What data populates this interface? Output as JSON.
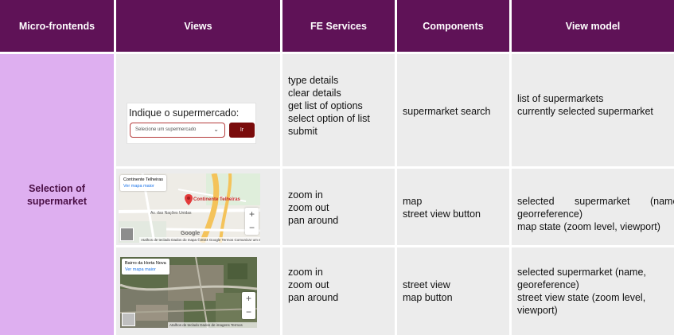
{
  "headers": {
    "micro_frontends": "Micro-frontends",
    "views": "Views",
    "fe_services": "FE Services",
    "components": "Components",
    "view_model": "View model"
  },
  "micro_frontend": {
    "name_line1": "Selection of",
    "name_line2": "supermarket"
  },
  "rows": [
    {
      "fe_services": [
        "type details",
        "clear details",
        "get list of options",
        "select option of list",
        "submit"
      ],
      "components": [
        "supermarket search"
      ],
      "view_model": [
        "list of supermarkets",
        "currently selected supermarket"
      ],
      "view": {
        "label": "Indique o supermercado:",
        "select_placeholder": "Selecione um supermercado",
        "button": "Ir"
      }
    },
    {
      "fe_services": [
        "zoom in",
        "zoom out",
        "pan around"
      ],
      "components": [
        "map",
        "street view button"
      ],
      "view_model": [
        "selected supermarket (name,",
        "georreference)",
        "map state (zoom level, viewport)"
      ],
      "view": {
        "place": "Continente Telheiras",
        "link": "Ver mapa maior",
        "pin_label": "Continente Telheiras",
        "street": "Av. das Nações Unidas",
        "attribution": "Atalhos de teclado   Dados do mapa ©2024 Google   Termos   Comunicar um erro no mapa",
        "logo": "Google",
        "zoom_in": "+",
        "zoom_out": "−"
      }
    },
    {
      "fe_services": [
        "zoom in",
        "zoom out",
        "pan around"
      ],
      "components": [
        "street view",
        "map button"
      ],
      "view_model": [
        "selected supermarket (name,",
        "georeference)",
        "street view state (zoom level,",
        "viewport)"
      ],
      "view": {
        "place": "Bairro da Horta Nova",
        "link": "Ver mapa maior",
        "attribution": "Atalhos de teclado   Dados de imagens   Termos",
        "zoom_in": "+",
        "zoom_out": "−"
      }
    }
  ],
  "colors": {
    "header_bg": "#5f1257",
    "micro_frontend_bg": "#deaff0",
    "cell_bg": "#ececec",
    "button_bg": "#7a0b0b"
  }
}
